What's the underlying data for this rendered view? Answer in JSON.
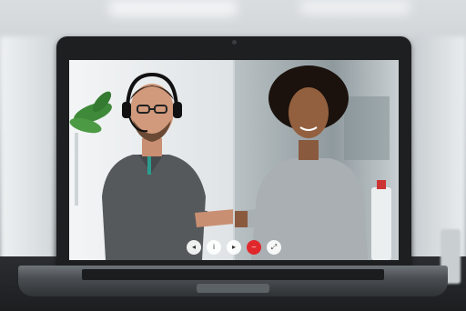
{
  "scene": {
    "description_icons": [
      "microphone-icon",
      "info-icon",
      "video-camera-icon",
      "end-call-icon",
      "fullscreen-icon"
    ]
  },
  "call_controls": [
    {
      "name": "microphone",
      "glyph": "◂"
    },
    {
      "name": "info",
      "glyph": "i"
    },
    {
      "name": "video",
      "glyph": "▸"
    },
    {
      "name": "end-call",
      "glyph": "–"
    },
    {
      "name": "fullscreen",
      "glyph": "⤢"
    }
  ],
  "colors": {
    "end_call": "#e0282c",
    "left_shirt": "#55595c",
    "right_shirt": "#a9afb3",
    "skin_left": "#c98f72",
    "skin_right": "#8a5a3f"
  }
}
